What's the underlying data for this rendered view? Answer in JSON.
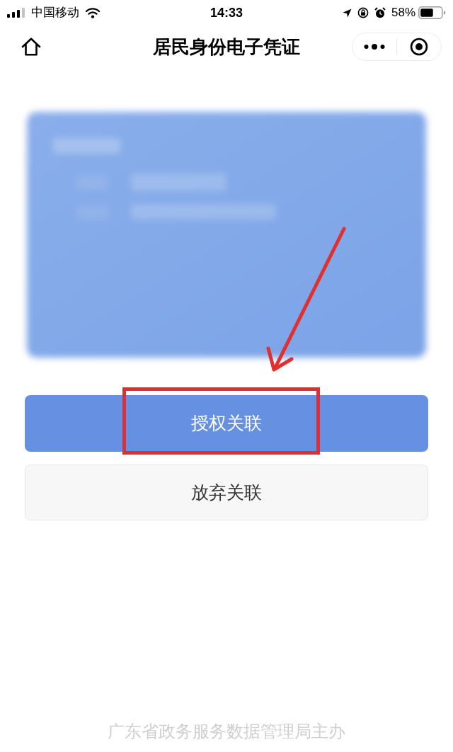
{
  "status_bar": {
    "carrier": "中国移动",
    "time": "14:33",
    "battery": "58%"
  },
  "nav_bar": {
    "title": "居民身份电子凭证"
  },
  "buttons": [
    {
      "label": "授权关联",
      "kind": "primary"
    },
    {
      "label": "放弃关联",
      "kind": "secondary"
    }
  ],
  "footer": [
    "广东省政务服务数据管理局主办"
  ]
}
